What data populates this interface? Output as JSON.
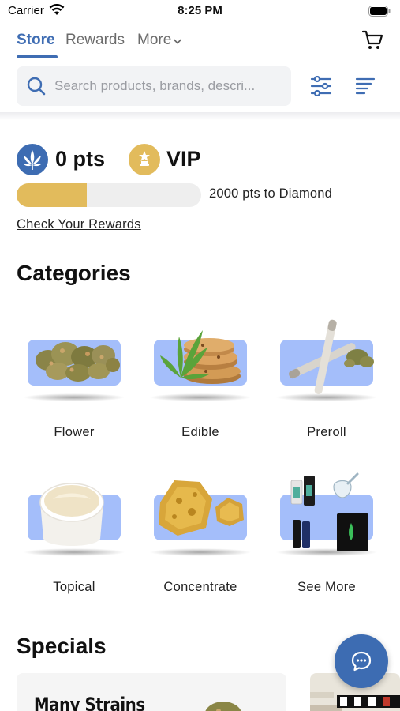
{
  "status_bar": {
    "carrier": "Carrier",
    "time": "8:25 PM"
  },
  "nav": {
    "tabs": [
      {
        "label": "Store",
        "active": true
      },
      {
        "label": "Rewards",
        "active": false
      },
      {
        "label": "More",
        "active": false
      }
    ],
    "accent_color": "#3f6db3"
  },
  "search": {
    "placeholder": "Search products, brands, descri..."
  },
  "rewards": {
    "points": "0 pts",
    "tier": "VIP",
    "progress_fraction": 0.38,
    "progress_label": "2000 pts to Diamond",
    "link": "Check Your Rewards",
    "progress_color": "#e2bb5c"
  },
  "categories": {
    "title": "Categories",
    "items": [
      {
        "label": "Flower",
        "icon": "flower-buds-image"
      },
      {
        "label": "Edible",
        "icon": "edible-cookies-image"
      },
      {
        "label": "Preroll",
        "icon": "preroll-joints-image"
      },
      {
        "label": "Topical",
        "icon": "topical-cream-jar-image"
      },
      {
        "label": "Concentrate",
        "icon": "concentrate-wax-image"
      },
      {
        "label": "See More",
        "icon": "accessories-collage-image"
      }
    ],
    "card_color": "#a4befa"
  },
  "specials": {
    "title": "Specials",
    "cards": [
      {
        "title": "Many Strains"
      }
    ]
  }
}
